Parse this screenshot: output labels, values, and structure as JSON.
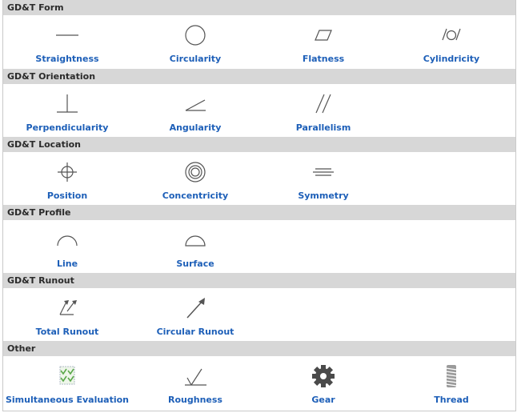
{
  "sections": [
    {
      "title": "GD&T Form",
      "items": [
        {
          "label": "Straightness",
          "icon": "straightness-icon"
        },
        {
          "label": "Circularity",
          "icon": "circularity-icon"
        },
        {
          "label": "Flatness",
          "icon": "flatness-icon"
        },
        {
          "label": "Cylindricity",
          "icon": "cylindricity-icon"
        }
      ]
    },
    {
      "title": "GD&T Orientation",
      "items": [
        {
          "label": "Perpendicularity",
          "icon": "perpendicularity-icon"
        },
        {
          "label": "Angularity",
          "icon": "angularity-icon"
        },
        {
          "label": "Parallelism",
          "icon": "parallelism-icon"
        }
      ]
    },
    {
      "title": "GD&T Location",
      "items": [
        {
          "label": "Position",
          "icon": "position-icon"
        },
        {
          "label": "Concentricity",
          "icon": "concentricity-icon"
        },
        {
          "label": "Symmetry",
          "icon": "symmetry-icon"
        }
      ]
    },
    {
      "title": "GD&T Profile",
      "items": [
        {
          "label": "Line",
          "icon": "profile-line-icon"
        },
        {
          "label": "Surface",
          "icon": "profile-surface-icon"
        }
      ]
    },
    {
      "title": "GD&T Runout",
      "items": [
        {
          "label": "Total Runout",
          "icon": "total-runout-icon"
        },
        {
          "label": "Circular Runout",
          "icon": "circular-runout-icon"
        }
      ]
    },
    {
      "title": "Other",
      "items": [
        {
          "label": "Simultaneous Evaluation",
          "icon": "simultaneous-evaluation-icon"
        },
        {
          "label": "Roughness",
          "icon": "roughness-icon"
        },
        {
          "label": "Gear",
          "icon": "gear-icon"
        },
        {
          "label": "Thread",
          "icon": "thread-icon"
        }
      ]
    }
  ],
  "colors": {
    "header_bg": "#d7d7d7",
    "label": "#1d5fb8",
    "icon_stroke": "#555555"
  }
}
